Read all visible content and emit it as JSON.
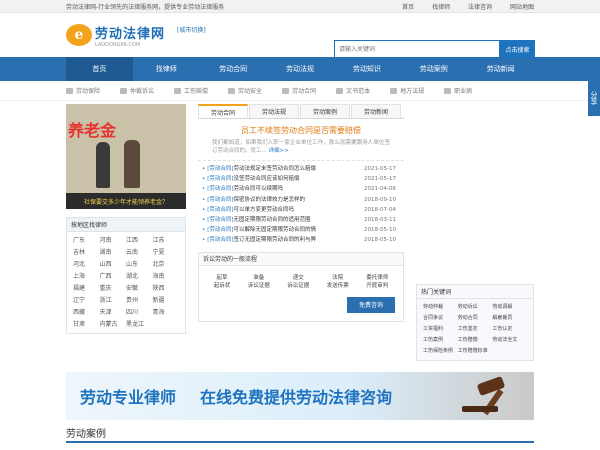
{
  "topbar": {
    "slogan": "劳动法律网-行业领先的法律服务网，提供专业劳动法律服务",
    "links": [
      "首页",
      "找律师",
      "法律咨询",
      "网站地图"
    ]
  },
  "logo": {
    "mark": "e",
    "name": "劳动法律网",
    "domain": "LAODONG66.COM"
  },
  "city_switch": "[城市切换]",
  "search": {
    "placeholder": "请输入关键词",
    "button": "点击搜索"
  },
  "nav": [
    "首页",
    "找律师",
    "劳动合同",
    "劳动法规",
    "劳动知识",
    "劳动案例",
    "劳动新闻"
  ],
  "subnav": [
    "劳动保险",
    "仲裁诉讼",
    "工伤赔偿",
    "劳动安全",
    "劳动合同",
    "文书范本",
    "地方法规",
    "职业病"
  ],
  "share": "分享",
  "banner": {
    "title": "养老金",
    "caption": "社保要交多少年才能领养老金？"
  },
  "region": {
    "header": "按地区找律师",
    "cities": [
      "广东",
      "河南",
      "江西",
      "江苏",
      "吉林",
      "湖南",
      "云南",
      "宁夏",
      "河北",
      "山西",
      "山东",
      "北京",
      "上海",
      "广西",
      "湖北",
      "海南",
      "福建",
      "重庆",
      "安徽",
      "陕西",
      "辽宁",
      "浙江",
      "贵州",
      "新疆",
      "西藏",
      "天津",
      "四川",
      "青海",
      "甘肃",
      "内蒙古",
      "黑龙江"
    ]
  },
  "tabs": [
    "劳动合同",
    "劳动法规",
    "劳动案例",
    "劳动新闻"
  ],
  "headline": {
    "title": "员工不续签劳动合同是否需要赔偿",
    "desc": "我们都知道，如果我们入职一家企业单位工作，那么就需要跟用人单位签订劳动合同的。员工...",
    "more": "详细>>"
  },
  "news": [
    {
      "tag": "[劳动合同]",
      "title": "劳动法规定未签劳动合同怎么赔偿",
      "date": "2021-05-17"
    },
    {
      "tag": "[劳动合同]",
      "title": "没签劳动合同应该如何赔偿",
      "date": "2021-05-17"
    },
    {
      "tag": "[劳动合同]",
      "title": "劳动合同可以续期吗",
      "date": "2021-04-06"
    },
    {
      "tag": "[劳动合同]",
      "title": "保密协议的法律效力是怎样的",
      "date": "2018-09-10"
    },
    {
      "tag": "[劳动合同]",
      "title": "可以单方变更劳动合同吗",
      "date": "2018-07-04"
    },
    {
      "tag": "[劳动合同]",
      "title": "无固定期限劳动合同的适用范围",
      "date": "2018-03-11"
    },
    {
      "tag": "[劳动合同]",
      "title": "可以解除无固定期限劳动合同的情",
      "date": "2018-05-10"
    },
    {
      "tag": "[劳动合同]",
      "title": "签订无固定期限劳动合同的利与弊",
      "date": "2018-05-10"
    }
  ],
  "flow": {
    "header": "诉讼劳动的一般流程",
    "steps": [
      [
        "起草",
        "起诉状"
      ],
      [
        "准备",
        "诉讼证据"
      ],
      [
        "递交",
        "诉讼证据"
      ],
      [
        "法院",
        "发送传票"
      ],
      [
        "委托律师",
        "开庭审判"
      ]
    ],
    "button": "免费咨询"
  },
  "hot": {
    "header": "热门关键词",
    "keywords": [
      "劳动仲裁",
      "劳动诉讼",
      "劳动调解",
      "合同争议",
      "劳动合同",
      "解雇裁员",
      "工资福利",
      "工伤鉴定",
      "工伤认定",
      "工伤案例",
      "工伤赔偿",
      "劳动法全文",
      "工伤保险条例",
      "工伤赔偿标准"
    ]
  },
  "ad": {
    "t1": "劳动专业律师",
    "t2": "在线免费提供劳动法律咨询"
  },
  "section_title": "劳动案例"
}
